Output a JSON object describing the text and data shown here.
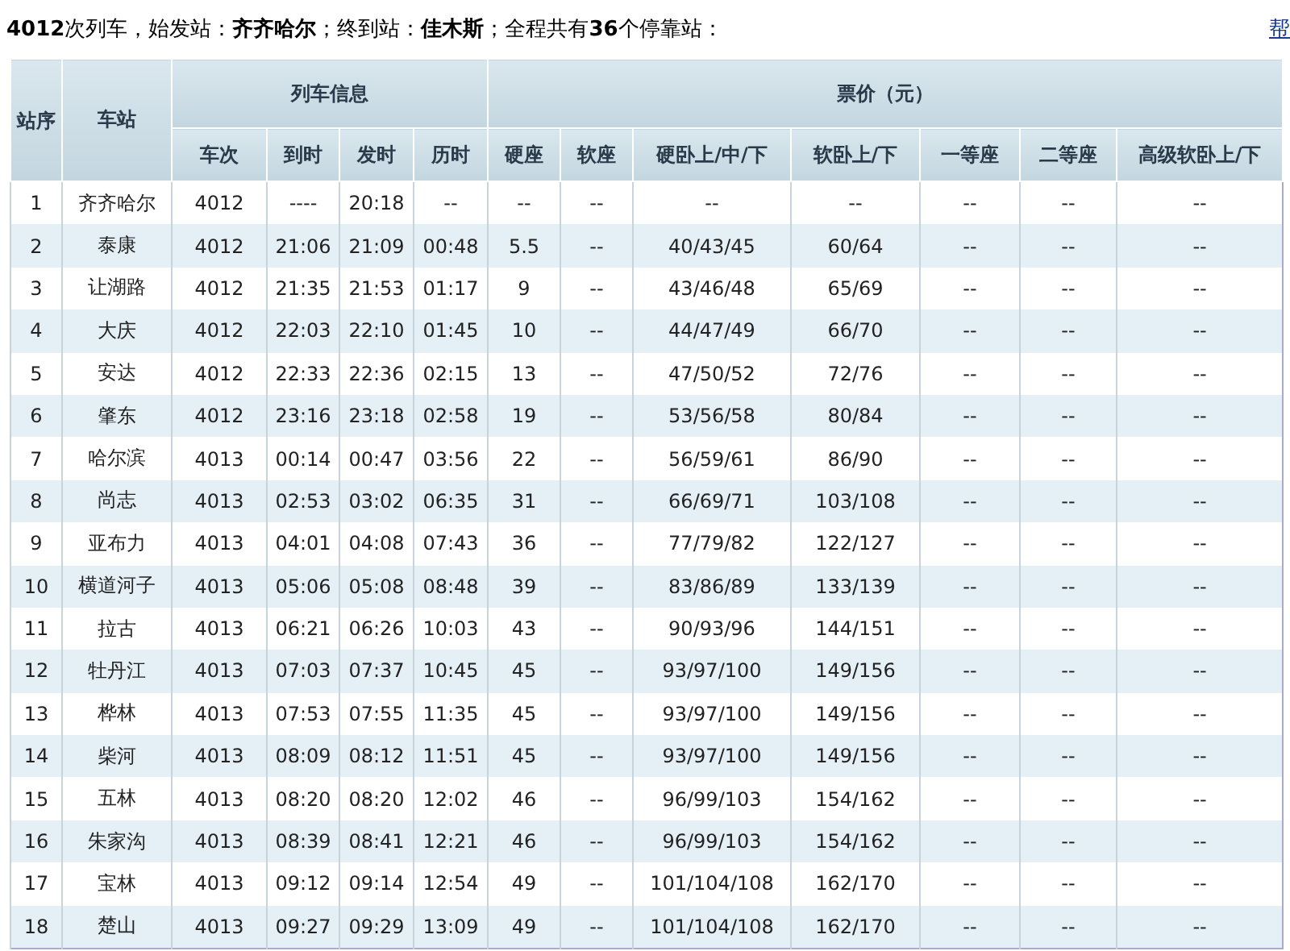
{
  "summary": {
    "text": "**4012**次列车，始发站：**齐齐哈尔**；终到站：**佳木斯**；全程共有**36**个停靠站：",
    "help_link": "帮"
  },
  "table": {
    "group_headers": [
      "列车信息",
      "票价（元）"
    ],
    "columns": [
      "站序",
      "车站",
      "车次",
      "到时",
      "发时",
      "历时",
      "硬座",
      "软座",
      "硬卧上/中/下",
      "软卧上/下",
      "一等座",
      "二等座",
      "高级软卧上/下"
    ],
    "rows": [
      [
        "1",
        "齐齐哈尔",
        "4012",
        "----",
        "20:18",
        "--",
        "--",
        "--",
        "--",
        "--",
        "--",
        "--",
        "--"
      ],
      [
        "2",
        "泰康",
        "4012",
        "21:06",
        "21:09",
        "00:48",
        "5.5",
        "--",
        "40/43/45",
        "60/64",
        "--",
        "--",
        "--"
      ],
      [
        "3",
        "让湖路",
        "4012",
        "21:35",
        "21:53",
        "01:17",
        "9",
        "--",
        "43/46/48",
        "65/69",
        "--",
        "--",
        "--"
      ],
      [
        "4",
        "大庆",
        "4012",
        "22:03",
        "22:10",
        "01:45",
        "10",
        "--",
        "44/47/49",
        "66/70",
        "--",
        "--",
        "--"
      ],
      [
        "5",
        "安达",
        "4012",
        "22:33",
        "22:36",
        "02:15",
        "13",
        "--",
        "47/50/52",
        "72/76",
        "--",
        "--",
        "--"
      ],
      [
        "6",
        "肇东",
        "4012",
        "23:16",
        "23:18",
        "02:58",
        "19",
        "--",
        "53/56/58",
        "80/84",
        "--",
        "--",
        "--"
      ],
      [
        "7",
        "哈尔滨",
        "4013",
        "00:14",
        "00:47",
        "03:56",
        "22",
        "--",
        "56/59/61",
        "86/90",
        "--",
        "--",
        "--"
      ],
      [
        "8",
        "尚志",
        "4013",
        "02:53",
        "03:02",
        "06:35",
        "31",
        "--",
        "66/69/71",
        "103/108",
        "--",
        "--",
        "--"
      ],
      [
        "9",
        "亚布力",
        "4013",
        "04:01",
        "04:08",
        "07:43",
        "36",
        "--",
        "77/79/82",
        "122/127",
        "--",
        "--",
        "--"
      ],
      [
        "10",
        "横道河子",
        "4013",
        "05:06",
        "05:08",
        "08:48",
        "39",
        "--",
        "83/86/89",
        "133/139",
        "--",
        "--",
        "--"
      ],
      [
        "11",
        "拉古",
        "4013",
        "06:21",
        "06:26",
        "10:03",
        "43",
        "--",
        "90/93/96",
        "144/151",
        "--",
        "--",
        "--"
      ],
      [
        "12",
        "牡丹江",
        "4013",
        "07:03",
        "07:37",
        "10:45",
        "45",
        "--",
        "93/97/100",
        "149/156",
        "--",
        "--",
        "--"
      ],
      [
        "13",
        "桦林",
        "4013",
        "07:53",
        "07:55",
        "11:35",
        "45",
        "--",
        "93/97/100",
        "149/156",
        "--",
        "--",
        "--"
      ],
      [
        "14",
        "柴河",
        "4013",
        "08:09",
        "08:12",
        "11:51",
        "45",
        "--",
        "93/97/100",
        "149/156",
        "--",
        "--",
        "--"
      ],
      [
        "15",
        "五林",
        "4013",
        "08:20",
        "08:20",
        "12:02",
        "46",
        "--",
        "96/99/103",
        "154/162",
        "--",
        "--",
        "--"
      ],
      [
        "16",
        "朱家沟",
        "4013",
        "08:39",
        "08:41",
        "12:21",
        "46",
        "--",
        "96/99/103",
        "154/162",
        "--",
        "--",
        "--"
      ],
      [
        "17",
        "宝林",
        "4013",
        "09:12",
        "09:14",
        "12:54",
        "49",
        "--",
        "101/104/108",
        "162/170",
        "--",
        "--",
        "--"
      ],
      [
        "18",
        "楚山",
        "4013",
        "09:27",
        "09:29",
        "13:09",
        "49",
        "--",
        "101/104/108",
        "162/170",
        "--",
        "--",
        "--"
      ]
    ]
  }
}
